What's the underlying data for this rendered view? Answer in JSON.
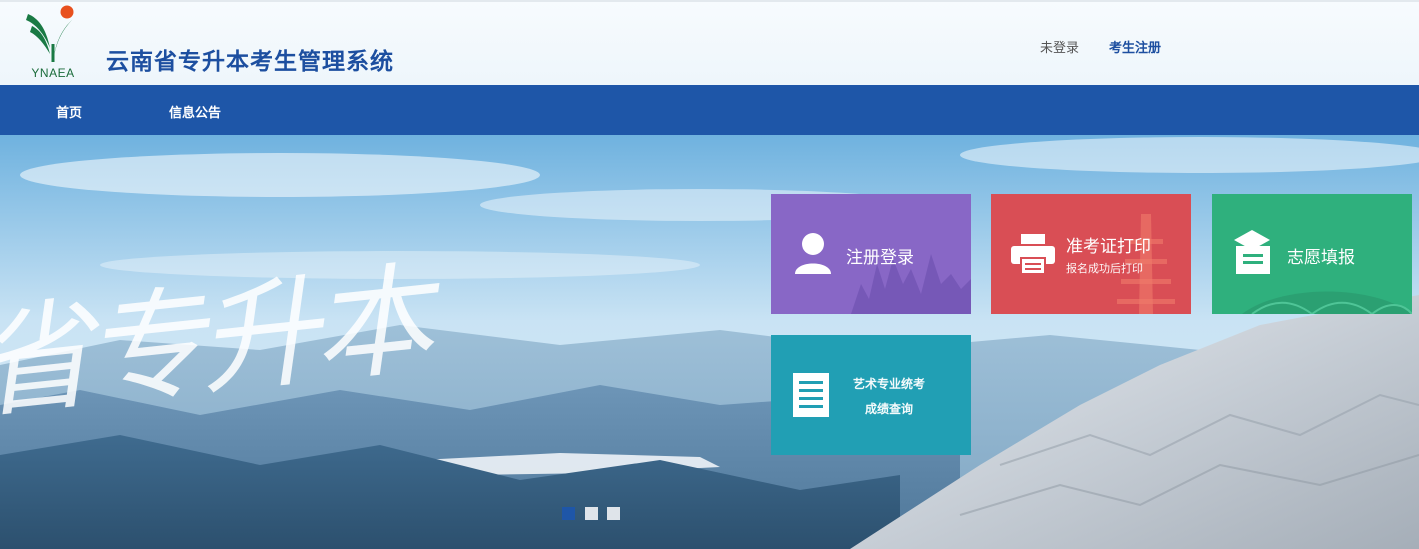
{
  "header": {
    "logo_text": "YNAEA",
    "site_title": "云南省专升本考生管理系统",
    "login_status": "未登录",
    "register_link": "考生注册"
  },
  "nav": {
    "items": [
      {
        "label": "首页"
      },
      {
        "label": "信息公告"
      }
    ]
  },
  "banner": {
    "slogan": "省专升本",
    "dots": 3,
    "active_dot": 0
  },
  "tiles": [
    {
      "title": "注册登录",
      "subtitle": "",
      "color": "#8867c6",
      "icon": "user-icon"
    },
    {
      "title": "准考证打印",
      "subtitle": "报名成功后打印",
      "color": "#d94e55",
      "icon": "printer-icon"
    },
    {
      "title": "志愿填报",
      "subtitle": "",
      "color": "#2fb07d",
      "icon": "form-icon"
    },
    {
      "title_line1": "艺术专业统考",
      "title_line2": "成绩查询",
      "color": "#219fb4",
      "icon": "document-icon"
    }
  ],
  "colors": {
    "nav_bg": "#1e56a8",
    "title": "#1d4fa0"
  }
}
